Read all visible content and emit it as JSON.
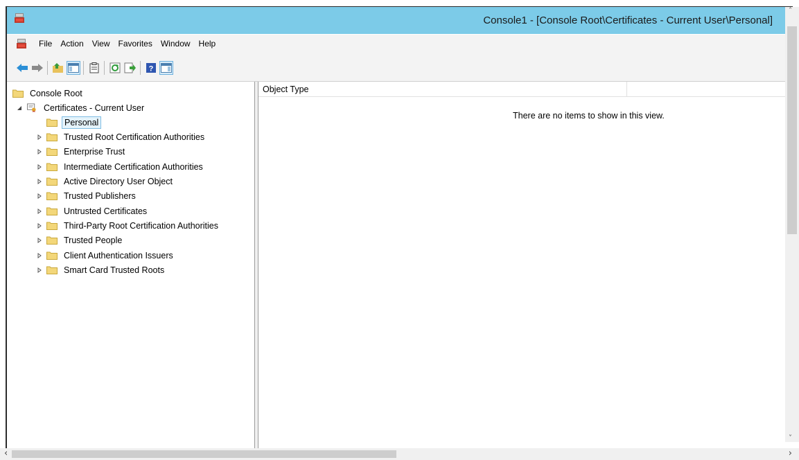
{
  "window": {
    "title": "Console1 - [Console Root\\Certificates - Current User\\Personal]"
  },
  "menu": {
    "items": [
      "File",
      "Action",
      "View",
      "Favorites",
      "Window",
      "Help"
    ]
  },
  "toolbar": {
    "buttons": [
      "back-icon",
      "forward-icon",
      "up-folder-icon",
      "show-hide-tree-icon",
      "clipboard-icon",
      "refresh-icon",
      "export-list-icon",
      "help-icon",
      "show-hide-action-pane-icon"
    ]
  },
  "tree": {
    "root": "Console Root",
    "store": "Certificates - Current User",
    "selected": "Personal",
    "children": [
      "Trusted Root Certification Authorities",
      "Enterprise Trust",
      "Intermediate Certification Authorities",
      "Active Directory User Object",
      "Trusted Publishers",
      "Untrusted Certificates",
      "Third-Party Root Certification Authorities",
      "Trusted People",
      "Client Authentication Issuers",
      "Smart Card Trusted Roots"
    ]
  },
  "list": {
    "column_header": "Object Type",
    "empty_message": "There are no items to show in this view."
  },
  "colors": {
    "titlebar": "#7ccbe8",
    "folder": "#f3d77a",
    "selection_bg": "#e5f3fb",
    "selection_border": "#7fbde3"
  }
}
